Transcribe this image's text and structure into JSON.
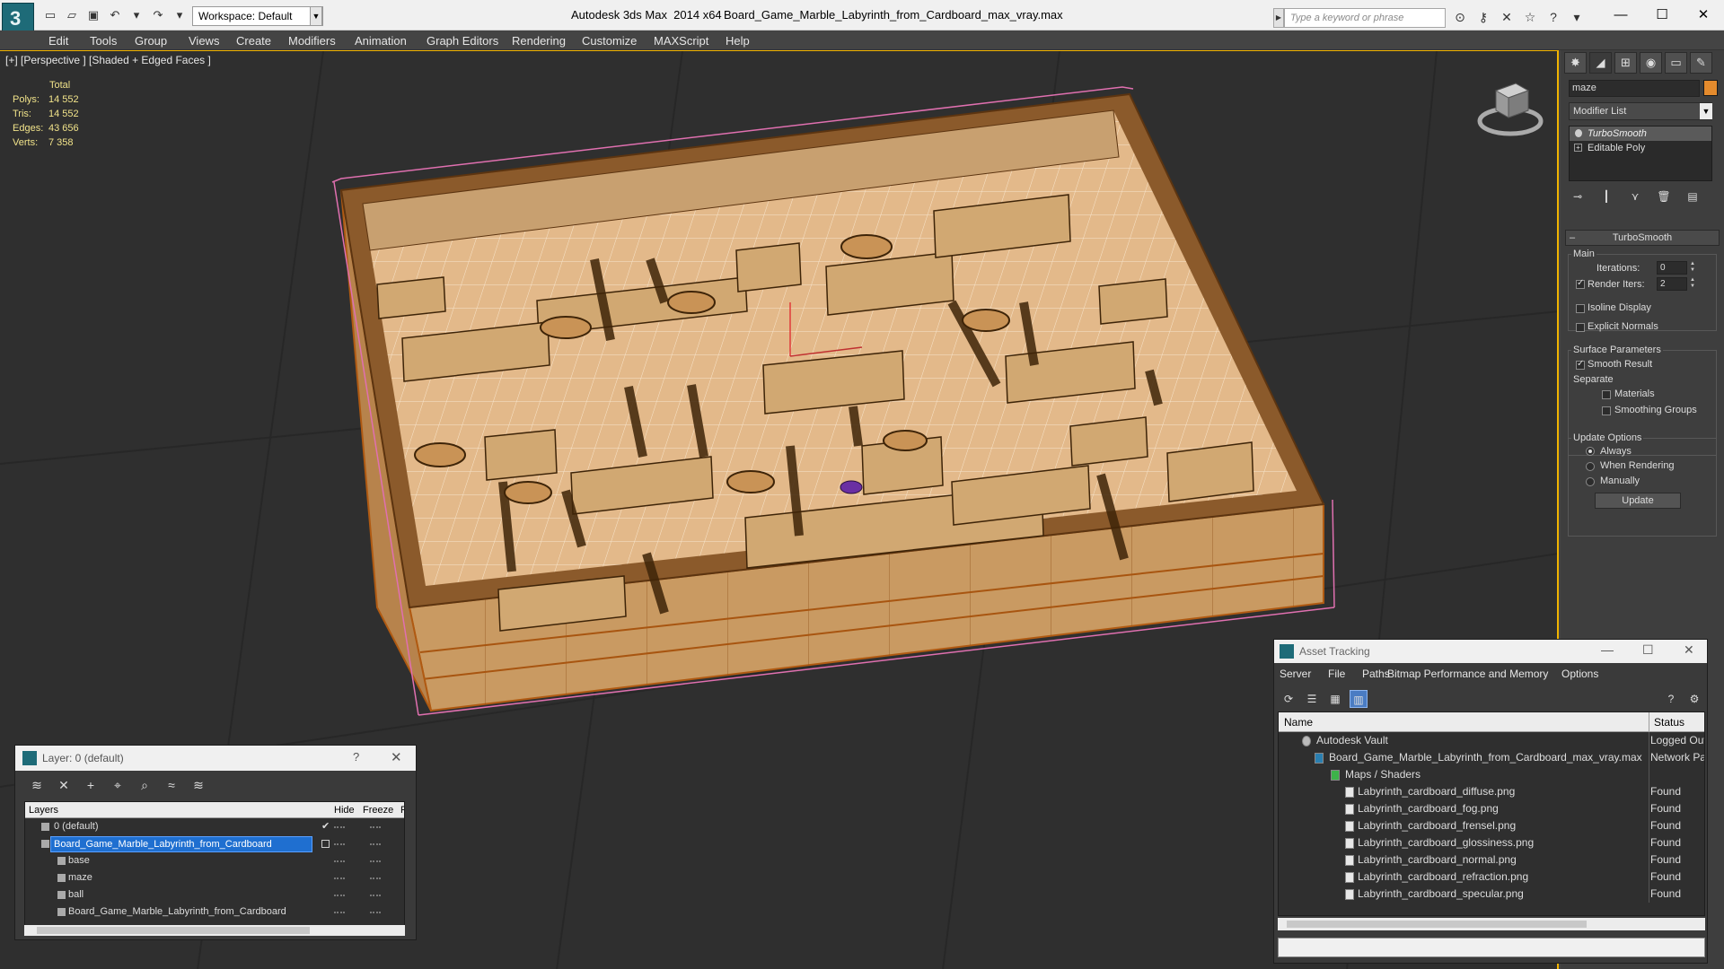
{
  "titlebar": {
    "workspace": "Workspace: Default",
    "app_title": "Autodesk 3ds Max  2014 x64",
    "file_name": "Board_Game_Marble_Labyrinth_from_Cardboard_max_vray.max",
    "search_placeholder": "Type a keyword or phrase"
  },
  "menubar": [
    "Edit",
    "Tools",
    "Group",
    "Views",
    "Create",
    "Modifiers",
    "Animation",
    "Graph Editors",
    "Rendering",
    "Customize",
    "MAXScript",
    "Help"
  ],
  "viewport": {
    "label": "[+] [Perspective ] [Shaded + Edged Faces ]",
    "stats": {
      "total_label": "Total",
      "rows": [
        {
          "key": "Polys:",
          "value": "14 552"
        },
        {
          "key": "Tris:",
          "value": "14 552"
        },
        {
          "key": "Edges:",
          "value": "43 656"
        },
        {
          "key": "Verts:",
          "value": "7 358"
        }
      ]
    }
  },
  "command_panel": {
    "object_name": "maze",
    "object_color": "#e58b2d",
    "modifier_list": "Modifier List",
    "stack": [
      "TurboSmooth",
      "Editable Poly"
    ],
    "rollout_title": "TurboSmooth",
    "main_label": "Main",
    "iterations_label": "Iterations:",
    "iterations_value": "0",
    "render_iters_label": "Render Iters:",
    "render_iters_value": "2",
    "isoline_label": "Isoline Display",
    "explicit_normals_label": "Explicit Normals",
    "surface_params_label": "Surface Parameters",
    "smooth_result_label": "Smooth Result",
    "separate_label": "Separate",
    "materials_label": "Materials",
    "smoothing_groups_label": "Smoothing Groups",
    "update_options_label": "Update Options",
    "always_label": "Always",
    "when_rendering_label": "When Rendering",
    "manually_label": "Manually",
    "update_button": "Update"
  },
  "layer_window": {
    "title": "Layer: 0 (default)",
    "help": "?",
    "col_layers": "Layers",
    "col_hide": "Hide",
    "col_freeze": "Freeze",
    "col_r": "R",
    "rows": [
      {
        "name": "0 (default)",
        "indent": 1
      },
      {
        "name": "Board_Game_Marble_Labyrinth_from_Cardboard",
        "indent": 1
      },
      {
        "name": "base",
        "indent": 2
      },
      {
        "name": "maze",
        "indent": 2
      },
      {
        "name": "ball",
        "indent": 2
      },
      {
        "name": "Board_Game_Marble_Labyrinth_from_Cardboard",
        "indent": 2
      }
    ]
  },
  "asset_window": {
    "title": "Asset Tracking",
    "menu": [
      "Server",
      "File",
      "Paths",
      "Bitmap Performance and Memory",
      "Options"
    ],
    "col_name": "Name",
    "col_status": "Status",
    "rows": [
      {
        "name": "Autodesk Vault",
        "status": "Logged Out",
        "indent": 1
      },
      {
        "name": "Board_Game_Marble_Labyrinth_from_Cardboard_max_vray.max",
        "status": "Network Pa",
        "indent": 2
      },
      {
        "name": "Maps / Shaders",
        "status": "",
        "indent": 3
      },
      {
        "name": "Labyrinth_cardboard_diffuse.png",
        "status": "Found",
        "indent": 4
      },
      {
        "name": "Labyrinth_cardboard_fog.png",
        "status": "Found",
        "indent": 4
      },
      {
        "name": "Labyrinth_cardboard_frensel.png",
        "status": "Found",
        "indent": 4
      },
      {
        "name": "Labyrinth_cardboard_glossiness.png",
        "status": "Found",
        "indent": 4
      },
      {
        "name": "Labyrinth_cardboard_normal.png",
        "status": "Found",
        "indent": 4
      },
      {
        "name": "Labyrinth_cardboard_refraction.png",
        "status": "Found",
        "indent": 4
      },
      {
        "name": "Labyrinth_cardboard_specular.png",
        "status": "Found",
        "indent": 4
      }
    ]
  }
}
